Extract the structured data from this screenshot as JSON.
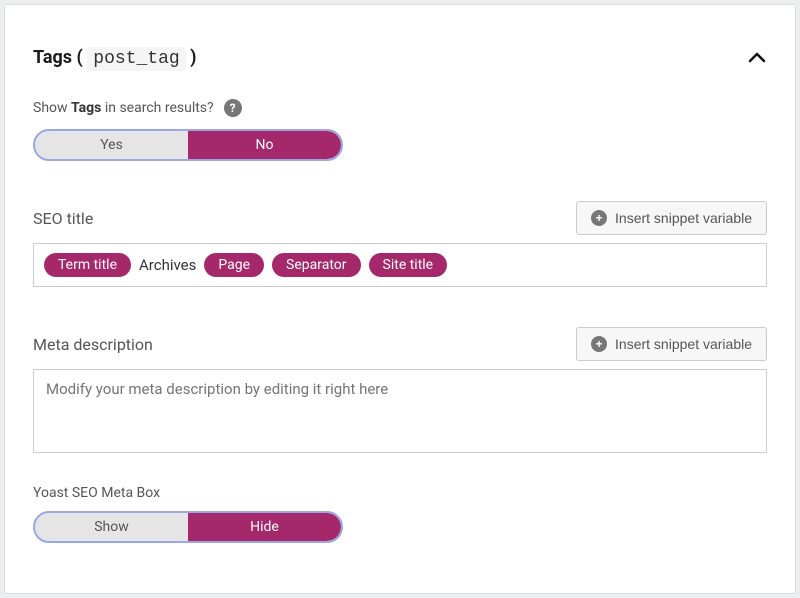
{
  "header": {
    "title_prefix": "Tags",
    "title_open_paren": "(",
    "title_code": "post_tag",
    "title_close_paren": ")"
  },
  "show_in_results": {
    "label_pre": "Show",
    "label_bold": "Tags",
    "label_post": "in search results?",
    "help": "?",
    "yes": "Yes",
    "no": "No",
    "selected": "no"
  },
  "seo_title": {
    "label": "SEO title",
    "insert_label": "Insert snippet variable",
    "tokens": [
      {
        "text": "Term title",
        "chip": true
      },
      {
        "text": "Archives",
        "chip": false
      },
      {
        "text": "Page",
        "chip": true
      },
      {
        "text": "Separator",
        "chip": true
      },
      {
        "text": "Site title",
        "chip": true
      }
    ]
  },
  "meta": {
    "label": "Meta description",
    "insert_label": "Insert snippet variable",
    "placeholder": "Modify your meta description by editing it right here"
  },
  "metabox": {
    "label": "Yoast SEO Meta Box",
    "show": "Show",
    "hide": "Hide",
    "selected": "hide"
  }
}
